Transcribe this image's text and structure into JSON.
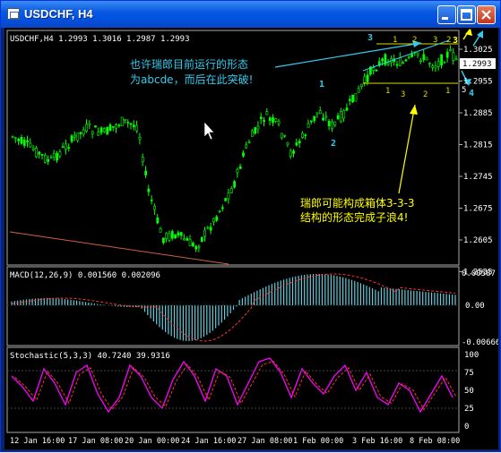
{
  "window": {
    "title": "USDCHF, H4"
  },
  "chart": {
    "symbol_header": "USDCHF,H4  1.2993 1.3016 1.2987 1.2993",
    "price_ticks": [
      "1.3025",
      "1.2955",
      "1.2885",
      "1.2815",
      "1.2745",
      "1.2675",
      "1.2605",
      "1.2535"
    ],
    "current_price": "1.2993",
    "annotation_cyan": [
      "也许瑞郎目前运行的形态",
      "为abcde，而后在此突破!"
    ],
    "annotation_yellow": [
      "瑞郎可能构成箱体3-3-3",
      "结构的形态完成子浪4!"
    ],
    "wave_labels_cyan": [
      "1",
      "2",
      "3",
      "3",
      "4"
    ],
    "box_top_labels": [
      "1",
      "2",
      "3",
      "2"
    ],
    "box_bottom_labels": [
      "1",
      "3",
      "2",
      "1"
    ],
    "right_marks": [
      "5",
      "4"
    ]
  },
  "macd": {
    "header": "MACD(12,26,9)  0.001560  0.002096",
    "ticks": [
      "0.00587",
      "0.00",
      "-0.00666"
    ]
  },
  "stochastic": {
    "header": "Stochastic(5,3,3)  40.7240  39.9316",
    "ticks": [
      "100",
      "75",
      "50",
      "25",
      "0"
    ]
  },
  "time_axis": [
    "12 Jan 16:00",
    "17 Jan 08:00",
    "20 Jan 00:00",
    "24 Jan 16:00",
    "27 Jan 08:00",
    "1 Feb 00:00",
    "3 Feb 16:00",
    "8 Feb 08:00"
  ],
  "colors": {
    "up": "#00FF00",
    "down": "#00FF00",
    "cyan": "#33CCEE",
    "yellow": "#FFFF00",
    "magenta": "#FF00FF",
    "signal": "#FF3333",
    "macd": "#66CCDD"
  }
}
